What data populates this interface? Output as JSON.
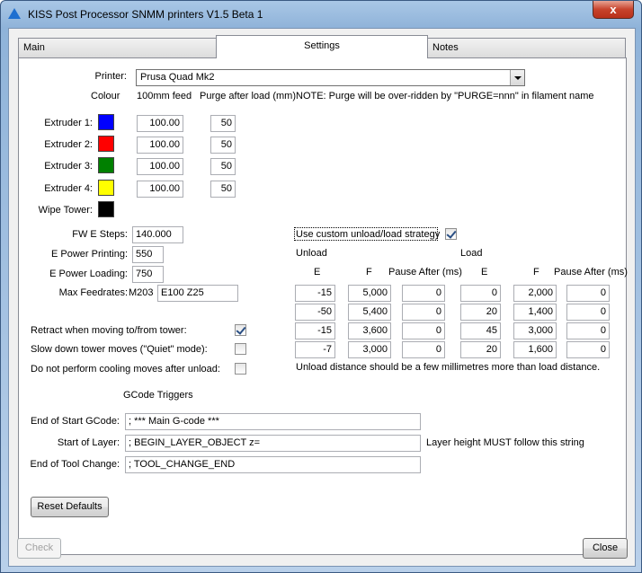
{
  "window": {
    "title": "KISS Post Processor SNMM printers  V1.5 Beta 1",
    "close_glyph": "x"
  },
  "tabs": [
    "Main",
    "Settings",
    "Notes"
  ],
  "printer": {
    "label": "Printer:",
    "value": "Prusa Quad Mk2"
  },
  "headers": {
    "colour": "Colour",
    "feed": "100mm feed",
    "purge": "Purge after load (mm)",
    "note": "NOTE: Purge will be over-ridden by \"PURGE=nnn\" in filament name"
  },
  "extruders": [
    {
      "label": "Extruder 1:",
      "color": "#0000ff",
      "feed": "100.00",
      "purge": "50"
    },
    {
      "label": "Extruder 2:",
      "color": "#ff0000",
      "feed": "100.00",
      "purge": "50"
    },
    {
      "label": "Extruder 3:",
      "color": "#008000",
      "feed": "100.00",
      "purge": "50"
    },
    {
      "label": "Extruder 4:",
      "color": "#ffff00",
      "feed": "100.00",
      "purge": "50"
    }
  ],
  "wipe_tower": {
    "label": "Wipe Tower:",
    "color": "#000000"
  },
  "fw": {
    "e_steps_label": "FW E Steps:",
    "e_steps": "140.000",
    "power_printing_label": "E Power Printing:",
    "power_printing": "550",
    "power_loading_label": "E Power Loading:",
    "power_loading": "750",
    "max_feed_label": "Max Feedrates:",
    "m203": "M203",
    "max_feed": "E100 Z25"
  },
  "strategy": {
    "label": "Use custom unload/load strategy",
    "checked": true,
    "unload_title": "Unload",
    "load_title": "Load",
    "col_e": "E",
    "col_f": "F",
    "col_pause": "Pause After (ms)",
    "rows": [
      {
        "ue": "-15",
        "uf": "5,000",
        "up": "0",
        "le": "0",
        "lf": "2,000",
        "lp": "0"
      },
      {
        "ue": "-50",
        "uf": "5,400",
        "up": "0",
        "le": "20",
        "lf": "1,400",
        "lp": "0"
      },
      {
        "ue": "-15",
        "uf": "3,600",
        "up": "0",
        "le": "45",
        "lf": "3,000",
        "lp": "0"
      },
      {
        "ue": "-7",
        "uf": "3,000",
        "up": "0",
        "le": "20",
        "lf": "1,600",
        "lp": "0"
      }
    ],
    "note": "Unload distance should be a few millimetres more than load distance."
  },
  "options": [
    {
      "label": "Retract when moving to/from tower:",
      "checked": true
    },
    {
      "label": "Slow down tower moves (\"Quiet\" mode):",
      "checked": false
    },
    {
      "label": "Do not perform cooling moves after unload:",
      "checked": false
    }
  ],
  "gcode": {
    "title": "GCode Triggers",
    "start_label": "End of Start GCode:",
    "start_value": "; *** Main G-code ***",
    "layer_label": "Start of Layer:",
    "layer_value": "; BEGIN_LAYER_OBJECT z=",
    "layer_note": "Layer height MUST follow this string",
    "tool_label": "End of Tool Change:",
    "tool_value": "; TOOL_CHANGE_END"
  },
  "buttons": {
    "reset": "Reset Defaults",
    "check": "Check",
    "close": "Close"
  }
}
